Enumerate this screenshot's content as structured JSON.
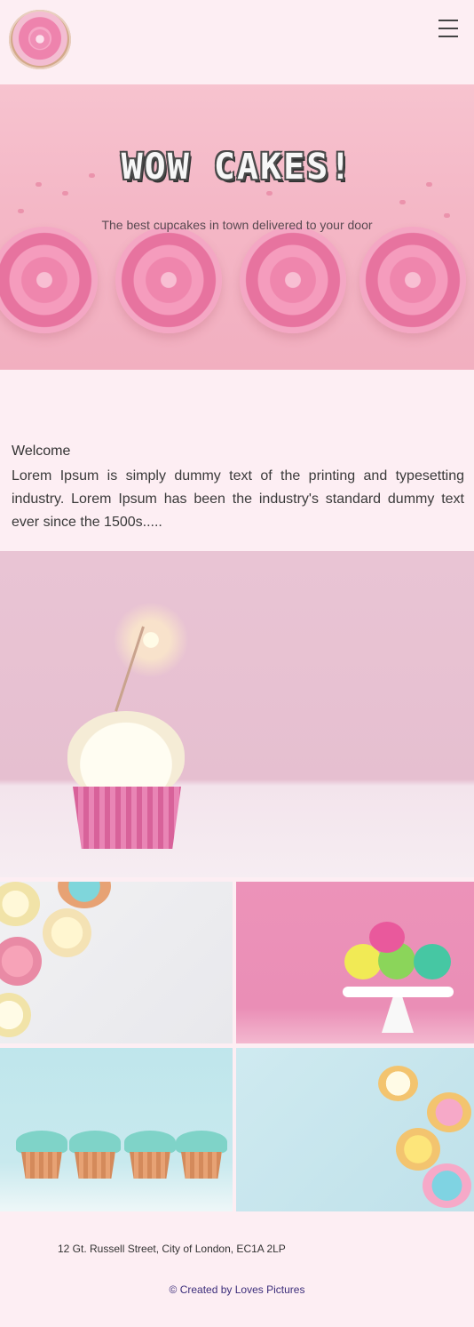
{
  "header": {
    "logo_icon": "cupcake-logo-icon",
    "menu_icon": "hamburger-menu-icon"
  },
  "hero": {
    "title": "WOW CAKES!",
    "subtitle": "The best cupcakes in town delivered to your door"
  },
  "welcome": {
    "title": "Welcome",
    "text": "Lorem Ipsum is simply dummy text of the printing and typesetting industry. Lorem Ipsum has been the industry's standard dummy text ever since the 1500s....."
  },
  "footer": {
    "address": "12 Gt. Russell Street, City of London, EC1A 2LP",
    "credit": "© Created by Loves Pictures"
  },
  "colors": {
    "background": "#fdeef3",
    "credit_link": "#3b2d7a"
  }
}
